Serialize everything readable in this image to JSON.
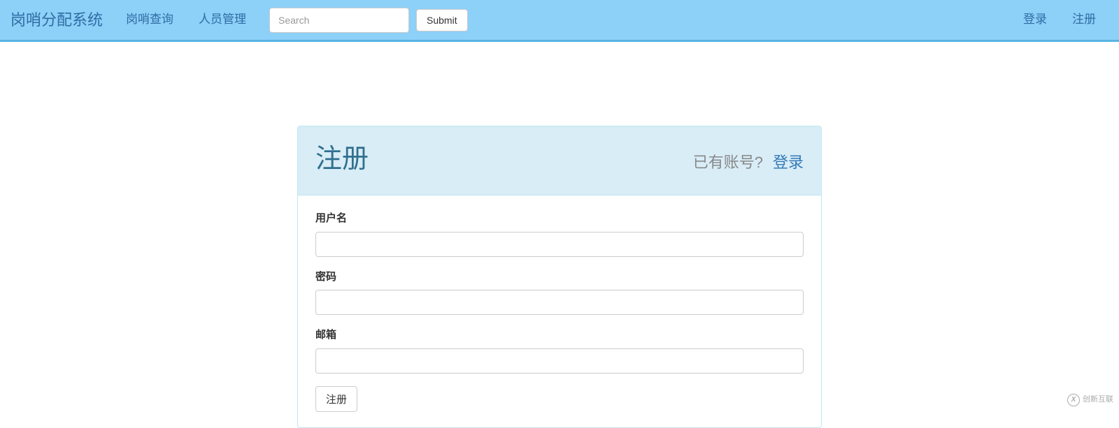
{
  "navbar": {
    "brand": "岗哨分配系统",
    "links": {
      "query": "岗哨查询",
      "manage": "人员管理"
    },
    "search": {
      "placeholder": "Search",
      "submit": "Submit"
    },
    "right": {
      "login": "登录",
      "register": "注册"
    }
  },
  "panel": {
    "title": "注册",
    "hasAccount": "已有账号?",
    "loginLink": "登录"
  },
  "form": {
    "username": {
      "label": "用户名",
      "value": ""
    },
    "password": {
      "label": "密码",
      "value": ""
    },
    "email": {
      "label": "邮箱",
      "value": ""
    },
    "submit": "注册"
  },
  "watermark": "创新互联"
}
